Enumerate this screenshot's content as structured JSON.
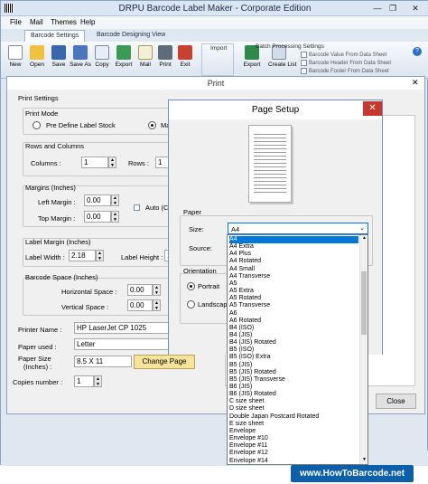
{
  "app": {
    "title": "DRPU Barcode Label Maker - Corporate Edition",
    "menu": [
      "File",
      "Mail",
      "Themes",
      "Help"
    ],
    "ribbon_tabs": [
      "Barcode Settings",
      "Barcode Designing View"
    ],
    "toolbar": [
      "New",
      "Open",
      "Save",
      "Save As",
      "Copy",
      "Export",
      "Mail",
      "Print",
      "Exit"
    ],
    "import_group": "Import",
    "import_buttons": [
      "Export",
      "Create List"
    ],
    "batch": {
      "title": "Batch Processing Settings",
      "items": [
        "Barcode Value From Data Sheet",
        "Barcode Header From Data Sheet",
        "Barcode Footer From Data Sheet"
      ]
    }
  },
  "print": {
    "title": "Print",
    "settings_title": "Print Settings",
    "mode_title": "Print Mode",
    "mode_options": [
      "Pre Define Label Stock",
      "Ma"
    ],
    "rows_columns_title": "Rows and Columns",
    "columns_label": "Columns :",
    "columns_value": "1",
    "rows_label": "Rows :",
    "rows_value": "1",
    "margins_title": "Margins (Inches)",
    "left_margin_label": "Left Margin :",
    "left_margin_value": "0.00",
    "top_margin_label": "Top Margin :",
    "top_margin_value": "0.00",
    "auto_label": "Auto (C",
    "label_margin_title": "Label Margin (Inches)",
    "label_width_label": "Label Width :",
    "label_width_value": "2.18",
    "label_height_label": "Label Height :",
    "label_height_value": "1",
    "barcode_space_title": "Barcode Space (Inches)",
    "horizontal_space_label": "Horizontal Space :",
    "horizontal_space_value": "0.00",
    "vertical_space_label": "Vertical Space :",
    "vertical_space_value": "0.00",
    "printer_name_label": "Printer Name :",
    "printer_name_value": "HP LaserJet CP 1025",
    "paper_used_label": "Paper used :",
    "paper_used_value": "Letter",
    "paper_size_label": "Paper Size",
    "paper_size_unit": "(Inches) :",
    "paper_size_value": "8.5 X 11",
    "change_page_button": "Change Page",
    "copies_label": "Copies number :",
    "copies_value": "1",
    "close_button": "Close"
  },
  "page_setup": {
    "title": "Page Setup",
    "close": "✕",
    "paper_group": "Paper",
    "size_label": "Size:",
    "size_value": "A4",
    "source_label": "Source:",
    "orientation_label": "Orientation",
    "portrait_label": "Portrait",
    "landscape_label": "Landscape",
    "size_options": [
      "A4",
      "A4 Extra",
      "A4 Plus",
      "A4 Rotated",
      "A4 Small",
      "A4 Transverse",
      "A5",
      "A5 Extra",
      "A5 Rotated",
      "A5 Transverse",
      "A6",
      "A6 Rotated",
      "B4 (ISO)",
      "B4 (JIS)",
      "B4 (JIS) Rotated",
      "B5 (ISO)",
      "B5 (ISO) Extra",
      "B5 (JIS)",
      "B5 (JIS) Rotated",
      "B5 (JIS) Transverse",
      "B6 (JIS)",
      "B6 (JIS) Rotated",
      "C size sheet",
      "D size sheet",
      "Double Japan Postcard Rotated",
      "E size sheet",
      "Envelope",
      "Envelope #10",
      "Envelope #11",
      "Envelope #12",
      "Envelope #14"
    ],
    "selected_index": 0
  },
  "watermark": "www.HowToBarcode.net",
  "colors": {
    "accent": "#0078d7",
    "close_red": "#c7372f",
    "watermark_bg": "#0c5fa8"
  }
}
